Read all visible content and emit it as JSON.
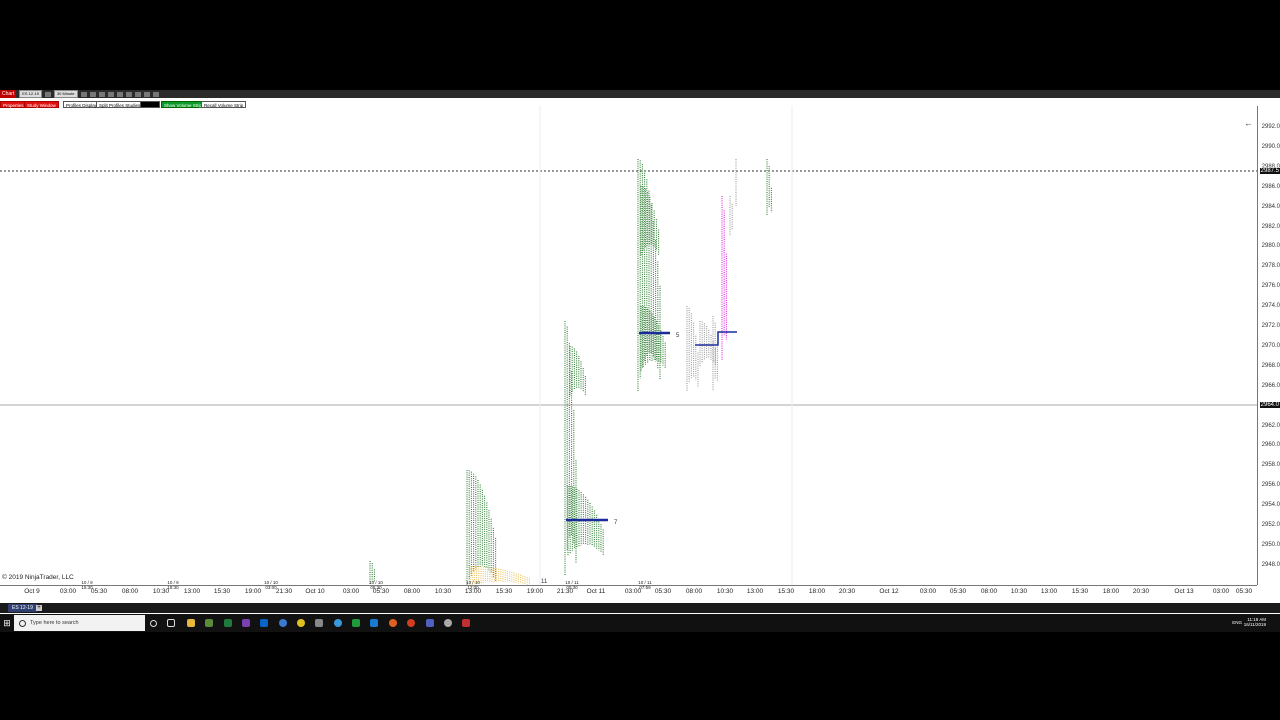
{
  "toolbar": {
    "chart_button": "Chart",
    "instrument": "ES 12-19",
    "interval": "30 Minute",
    "buttons": [
      {
        "label": "Properties",
        "style": "red"
      },
      {
        "label": "Study Window",
        "style": "red"
      },
      {
        "label": "Profiles Display",
        "style": "white"
      },
      {
        "label": "Split Profiles Studies",
        "style": "white"
      },
      {
        "label": "Show Volume Strip",
        "style": "green"
      },
      {
        "label": "Recall Volume Strip",
        "style": "white"
      }
    ]
  },
  "price_axis": {
    "labels": [
      "2992.0",
      "2990.0",
      "2988.0",
      "2986.0",
      "2984.0",
      "2982.0",
      "2980.0",
      "2978.0",
      "2976.0",
      "2974.0",
      "2972.0",
      "2970.0",
      "2968.0",
      "2966.0",
      "2964.0",
      "2962.0",
      "2960.0",
      "2958.0",
      "2956.0",
      "2954.0",
      "2952.0",
      "2950.0",
      "2948.0"
    ],
    "highlight_top": "2987.5",
    "highlight_mid": "2964.0"
  },
  "time_axis": {
    "labels": [
      "Oct 9",
      "03:00",
      "05:30",
      "08:00",
      "10:30",
      "13:00",
      "15:30",
      "19:00",
      "21:30",
      "Oct 10",
      "03:00",
      "05:30",
      "08:00",
      "10:30",
      "13:00",
      "15:30",
      "19:00",
      "21:30",
      "Oct 11",
      "03:00",
      "05:30",
      "08:00",
      "10:30",
      "13:00",
      "15:30",
      "18:00",
      "20:30",
      "Oct 12",
      "03:00",
      "05:30",
      "08:00",
      "10:30",
      "13:00",
      "15:30",
      "18:00",
      "20:30",
      "Oct 13",
      "03:00",
      "05:30"
    ]
  },
  "session_labels": [
    "10 / 9\n15:30",
    "10 / 9\n18:30",
    "10 / 10\n03:00",
    "10 / 10\n05:30",
    "10 / 10\n12:00",
    "10 / 11\n00:30",
    "10 / 11\n07:59"
  ],
  "poc_labels": [
    "5",
    "7",
    "11"
  ],
  "copyright": "© 2019 NinjaTrader, LLC",
  "back_arrow": "←",
  "tab": {
    "label": "ES 12-19",
    "add": "+"
  },
  "taskbar": {
    "search_placeholder": "Type here to search",
    "language": "ENG",
    "time": "11:18 AM",
    "date": "16/11/2019"
  },
  "colors": {
    "poc_line": "#1c2b9c",
    "profile_green": "#2e7d32",
    "profile_magenta": "#e020e0",
    "profile_gray": "#9a9a9a",
    "profile_yellow": "#e8c060"
  }
}
